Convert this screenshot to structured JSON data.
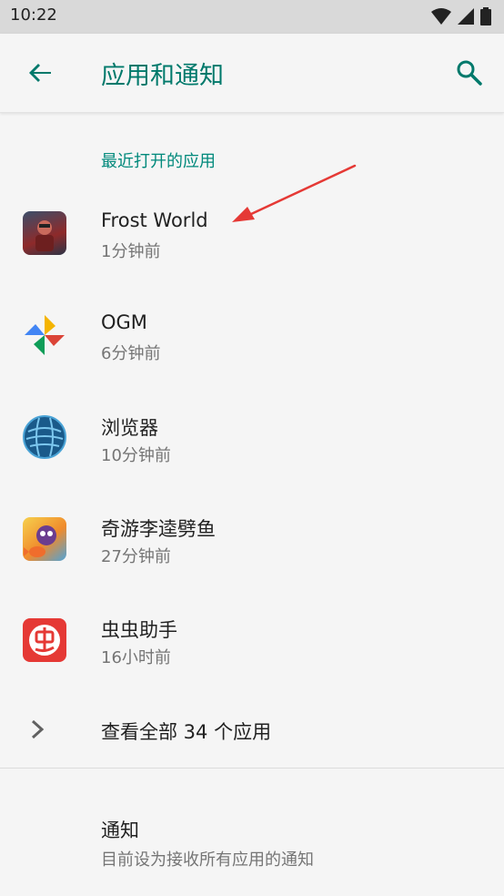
{
  "status_bar": {
    "time": "10:22"
  },
  "app_bar": {
    "title": "应用和通知"
  },
  "recent": {
    "header": "最近打开的应用",
    "apps": [
      {
        "name": "Frost World",
        "time": "1分钟前",
        "icon": "frost-world-icon"
      },
      {
        "name": "OGM",
        "time": "6分钟前",
        "icon": "ogm-icon"
      },
      {
        "name": "浏览器",
        "time": "10分钟前",
        "icon": "browser-icon"
      },
      {
        "name": "奇游李逵劈鱼",
        "time": "27分钟前",
        "icon": "fish-game-icon"
      },
      {
        "name": "虫虫助手",
        "time": "16小时前",
        "icon": "chongchong-icon"
      }
    ]
  },
  "see_all": {
    "label": "查看全部 34 个应用"
  },
  "notifications": {
    "title": "通知",
    "subtitle": "目前设为接收所有应用的通知"
  },
  "colors": {
    "accent": "#00897b",
    "annotation": "#e53935"
  }
}
